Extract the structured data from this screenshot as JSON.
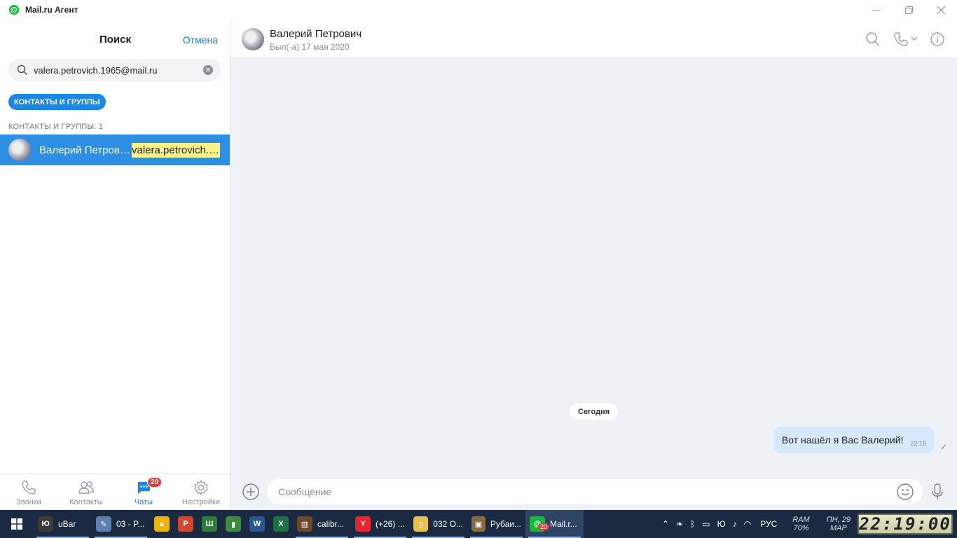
{
  "window": {
    "title": "Mail.ru Агент",
    "logo_glyph": "@"
  },
  "sidebar": {
    "title": "Поиск",
    "cancel_label": "Отмена",
    "search_value": "valera.petrovich.1965@mail.ru",
    "filter_chip": "КОНТАКТЫ И ГРУППЫ",
    "section_label": "КОНТАКТЫ И ГРУППЫ: 1",
    "results": [
      {
        "name": "Валерий Петрович",
        "email": "valera.petrovich.1965@mail.ru"
      }
    ]
  },
  "bottom_nav": {
    "items": [
      {
        "label": "Звонки",
        "icon": "phone-icon"
      },
      {
        "label": "Контакты",
        "icon": "contacts-icon"
      },
      {
        "label": "Чаты",
        "icon": "chats-icon",
        "badge": "20",
        "active": true
      },
      {
        "label": "Настройки",
        "icon": "gear-icon"
      }
    ]
  },
  "chat": {
    "contact_name": "Валерий Петрович",
    "status": "Был(-а) 17 мая 2020",
    "date_separator": "Сегодня",
    "messages": [
      {
        "text": "Вот нашёл я Вас Валерий!",
        "time": "22:18",
        "outgoing": true,
        "delivered_mark": "✓"
      }
    ],
    "composer_placeholder": "Сообщение"
  },
  "taskbar": {
    "items": [
      {
        "label": "uBar",
        "glyph": "Ю",
        "color": "#3a3a3a"
      },
      {
        "label": "03 - P...",
        "glyph": "✎",
        "color": "#5d7fb0"
      },
      {
        "label": "",
        "glyph": "▲",
        "color": "#f0b400"
      },
      {
        "label": "",
        "glyph": "P",
        "color": "#d9452b"
      },
      {
        "label": "",
        "glyph": "Ш",
        "color": "#2f7d3a"
      },
      {
        "label": "",
        "glyph": "▮",
        "color": "#3b8c3b"
      },
      {
        "label": "",
        "glyph": "W",
        "color": "#2b5797"
      },
      {
        "label": "",
        "glyph": "X",
        "color": "#1e7145"
      },
      {
        "label": "calibr...",
        "glyph": "▥",
        "color": "#6b4a2a"
      },
      {
        "label": "(+26) ...",
        "glyph": "Y",
        "color": "#e8242f"
      },
      {
        "label": "032 O...",
        "glyph": "▯",
        "color": "#e8c04a"
      },
      {
        "label": "Рубаи...",
        "glyph": "▣",
        "color": "#8a6b3d"
      },
      {
        "label": "Mail.r...",
        "glyph": "@",
        "color": "#19b83a",
        "badge": "20",
        "current": true
      }
    ],
    "tray": {
      "language": "РУС",
      "ram_label": "RAM",
      "ram_value": "70%",
      "day": "ПН, 29",
      "month": "МАР",
      "clock": "22:19:00"
    }
  }
}
